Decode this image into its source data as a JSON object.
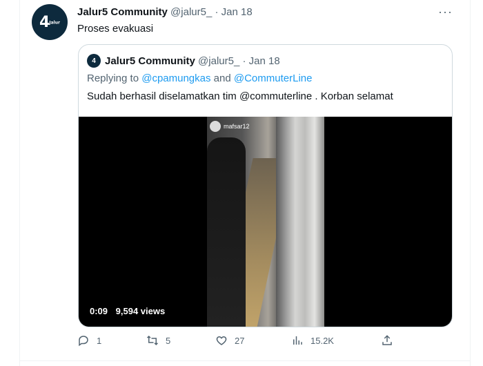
{
  "tweet": {
    "author_name": "Jalur5 Community",
    "handle": "@jalur5_",
    "separator": "·",
    "date": "Jan 18",
    "text": "Proses evakuasi",
    "more_label": "···"
  },
  "quoted": {
    "author_name": "Jalur5 Community",
    "handle": "@jalur5_",
    "separator": "·",
    "date": "Jan 18",
    "reply_prefix": "Replying to",
    "reply_user1": "@cpamungkas",
    "reply_and": "and",
    "reply_user2": "@CommuterLine",
    "text": "Sudah berhasil diselamatkan tim @commuterline . Korban selamat"
  },
  "media": {
    "overlay_username": "mafsar12",
    "duration": "0:09",
    "views": "9,594 views"
  },
  "actions": {
    "replies": "1",
    "retweets": "5",
    "likes": "27",
    "views": "15.2K"
  },
  "colors": {
    "link": "#1d9bf0",
    "muted": "#536471",
    "avatar_bg": "#0d2a3d"
  }
}
